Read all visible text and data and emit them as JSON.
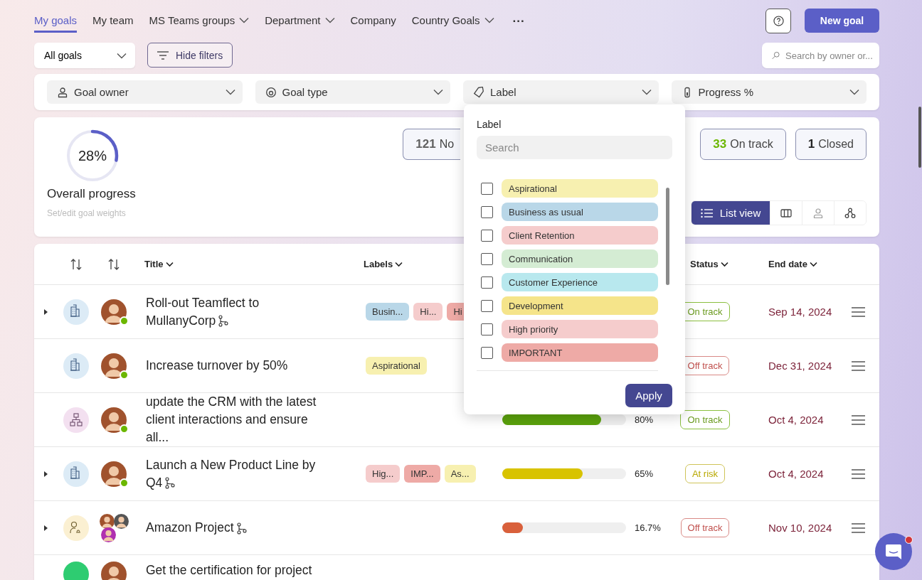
{
  "nav": {
    "tabs": [
      {
        "label": "My goals",
        "selected": true,
        "dropdown": false
      },
      {
        "label": "My team",
        "selected": false,
        "dropdown": false
      },
      {
        "label": "MS Teams groups",
        "selected": false,
        "dropdown": true
      },
      {
        "label": "Department",
        "selected": false,
        "dropdown": true
      },
      {
        "label": "Company",
        "selected": false,
        "dropdown": false
      },
      {
        "label": "Country Goals",
        "selected": false,
        "dropdown": true
      }
    ],
    "more": "···"
  },
  "new_goal_button": "New goal",
  "goals_select": {
    "value": "All goals"
  },
  "hide_filters_button": "Hide filters",
  "search": {
    "placeholder": "Search by owner or..."
  },
  "filters": [
    {
      "kind": "owner",
      "label": "Goal owner"
    },
    {
      "kind": "type",
      "label": "Goal type"
    },
    {
      "kind": "label",
      "label": "Label"
    },
    {
      "kind": "progress",
      "label": "Progress %"
    }
  ],
  "summary": {
    "progress": {
      "value": "28%"
    },
    "title": "Overall progress",
    "link": "Set/edit goal weights",
    "stats": [
      {
        "count": "121",
        "label": "No",
        "color": "#616161",
        "clipped": true
      },
      {
        "count": "33",
        "label": "On track",
        "color": "#6bb700",
        "clipped": false
      },
      {
        "count": "1",
        "label": "Closed",
        "color": "#242424",
        "clipped": false
      }
    ],
    "views": [
      {
        "kind": "list",
        "label": "List view",
        "selected": true
      },
      {
        "kind": "board",
        "selected": false
      },
      {
        "kind": "person",
        "selected": false
      },
      {
        "kind": "tree",
        "selected": false
      }
    ]
  },
  "table": {
    "columns": [
      {
        "kind": "sort"
      },
      {
        "kind": "sort"
      },
      {
        "kind": "text",
        "label": "Title"
      },
      {
        "kind": "text",
        "label": "Labels"
      },
      {
        "kind": "text",
        "label": "Status"
      },
      {
        "kind": "text",
        "label": "End date"
      }
    ],
    "rows": [
      {
        "expandable": true,
        "kind": "company",
        "owners": [
          {
            "kind": "person",
            "online": true
          }
        ],
        "title": "Roll-out Teamflect to MullanyCorp",
        "linked": true,
        "labels": [
          {
            "text": "Busin...",
            "color": "#b9d7e8"
          },
          {
            "text": "Hi...",
            "color": "#f5cccc"
          },
          {
            "text": "Hi",
            "color": "#eeaaa6"
          }
        ],
        "status": {
          "kind": "on_track",
          "text": "On track"
        },
        "end_date": "Sep 14, 2024"
      },
      {
        "expandable": false,
        "kind": "company",
        "owners": [
          {
            "kind": "person",
            "online": true
          }
        ],
        "title": "Increase turnover by 50%",
        "linked": false,
        "labels": [
          {
            "text": "Aspirational",
            "color": "#f7f0b0"
          }
        ],
        "status": {
          "kind": "off_track",
          "text": "Off track"
        },
        "end_date": "Dec 31, 2024"
      },
      {
        "expandable": false,
        "kind": "team",
        "owners": [
          {
            "kind": "person",
            "online": true
          }
        ],
        "title": "update the CRM with the latest client interactions and ensure all...",
        "linked": false,
        "labels": [],
        "progress": {
          "level": 0.8,
          "reading": "80%"
        },
        "status": {
          "kind": "on_track",
          "text": "On track"
        },
        "end_date": "Oct 4, 2024"
      },
      {
        "expandable": true,
        "kind": "company",
        "owners": [
          {
            "kind": "person",
            "online": true
          }
        ],
        "title": "Launch a New Product Line by Q4",
        "linked": true,
        "labels": [
          {
            "text": "Hig...",
            "color": "#f5cccc"
          },
          {
            "text": "IMP...",
            "color": "#eeaaa6"
          },
          {
            "text": "As...",
            "color": "#f7f0b0"
          }
        ],
        "progress": {
          "level": 0.65,
          "reading": "65%"
        },
        "status": {
          "kind": "at_risk",
          "text": "At risk"
        },
        "end_date": "Oct 4, 2024"
      },
      {
        "expandable": true,
        "kind": "personal",
        "owners": [
          {
            "kind": "person"
          },
          {
            "kind": "person"
          },
          {
            "kind": "person"
          }
        ],
        "title": "Amazon Project",
        "linked": true,
        "labels": [],
        "progress": {
          "level": 0.167,
          "reading": "16.7%"
        },
        "status": {
          "kind": "off_track",
          "text": "Off track"
        },
        "end_date": "Nov 10, 2024"
      },
      {
        "kind": "other",
        "owners": [
          {
            "kind": "person"
          }
        ],
        "title": "Get the certification for project",
        "labels": []
      }
    ]
  },
  "label_menu": {
    "title": "Label",
    "search_placeholder": "Search",
    "options": [
      {
        "text": "Aspirational",
        "color": "#f7f0b0",
        "checked": false
      },
      {
        "text": "Business as usual",
        "color": "#b9d7e8",
        "checked": false
      },
      {
        "text": "Client Retention",
        "color": "#f5cccc",
        "checked": false
      },
      {
        "text": "Communication",
        "color": "#d4ecd3",
        "checked": false
      },
      {
        "text": "Customer Experience",
        "color": "#b8e8ee",
        "checked": false
      },
      {
        "text": "Development",
        "color": "#f5e48a",
        "checked": false
      },
      {
        "text": "High priority",
        "color": "#f5cccc",
        "checked": false
      },
      {
        "text": "IMPORTANT",
        "color": "#eeaaa6",
        "checked": false
      }
    ],
    "apply_button": "Apply"
  }
}
